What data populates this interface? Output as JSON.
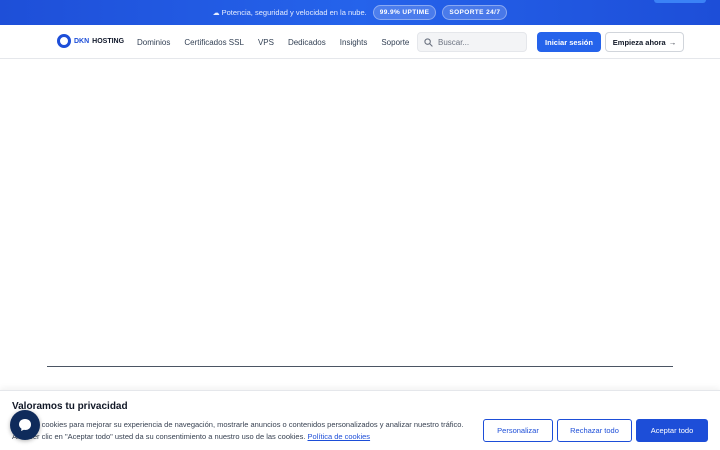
{
  "announcement": {
    "message": "Potencia, seguridad y velocidad en la nube.",
    "badges": [
      "99.9% UPTIME",
      "SOPORTE 24/7"
    ]
  },
  "header": {
    "logo": {
      "part1": "DKN",
      "part2": "HOSTING"
    },
    "nav": [
      "Dominios",
      "Certificados SSL",
      "VPS",
      "Dedicados",
      "Insights",
      "Soporte"
    ],
    "search_placeholder": "Buscar...",
    "login_label": "Iniciar sesión",
    "start_label": "Empieza ahora",
    "start_arrow": "→"
  },
  "cookie_banner": {
    "title": "Valoramos tu privacidad",
    "text": "Usamos cookies para mejorar su experiencia de navegación, mostrarle anuncios o contenidos personalizados y analizar nuestro tráfico. Al hacer clic en \"Aceptar todo\" usted da su consentimiento a nuestro uso de las cookies.",
    "policy_link": "Política de cookies",
    "customize_label": "Personalizar",
    "reject_label": "Rechazar todo",
    "accept_label": "Aceptar todo"
  },
  "colors": {
    "brand_blue": "#2563eb",
    "dark_blue": "#1d4ed8",
    "chat_bg": "#0f2b5b"
  },
  "icons": {
    "search": "search-icon",
    "chat": "chat-bubble-icon",
    "cloud": "cloud-icon",
    "arrow": "arrow-right-icon"
  }
}
